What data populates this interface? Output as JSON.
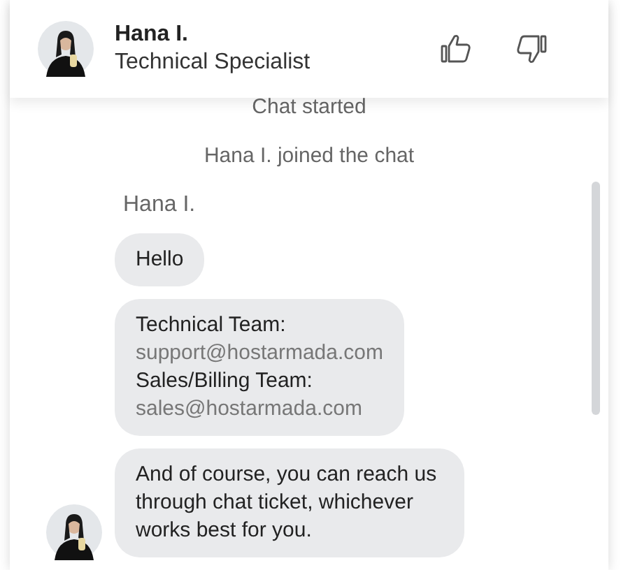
{
  "header": {
    "name": "Hana I.",
    "role": "Technical Specialist",
    "rating": {
      "thumbs_up": false,
      "thumbs_down": false
    }
  },
  "events": [
    "Chat started",
    "Hana I. joined the chat"
  ],
  "sender": "Hana I.",
  "messages": [
    {
      "show_avatar": false,
      "lines": [
        {
          "kind": "text",
          "text": "Hello"
        }
      ]
    },
    {
      "show_avatar": false,
      "lines": [
        {
          "kind": "text",
          "text": "Technical Team:"
        },
        {
          "kind": "email",
          "text": "support@hostarmada.com"
        },
        {
          "kind": "text",
          "text": "Sales/Billing Team:"
        },
        {
          "kind": "email",
          "text": "sales@hostarmada.com"
        }
      ]
    },
    {
      "show_avatar": true,
      "lines": [
        {
          "kind": "text",
          "text": "And of course, you can reach us through chat ticket, whichever works best for you."
        }
      ]
    }
  ]
}
